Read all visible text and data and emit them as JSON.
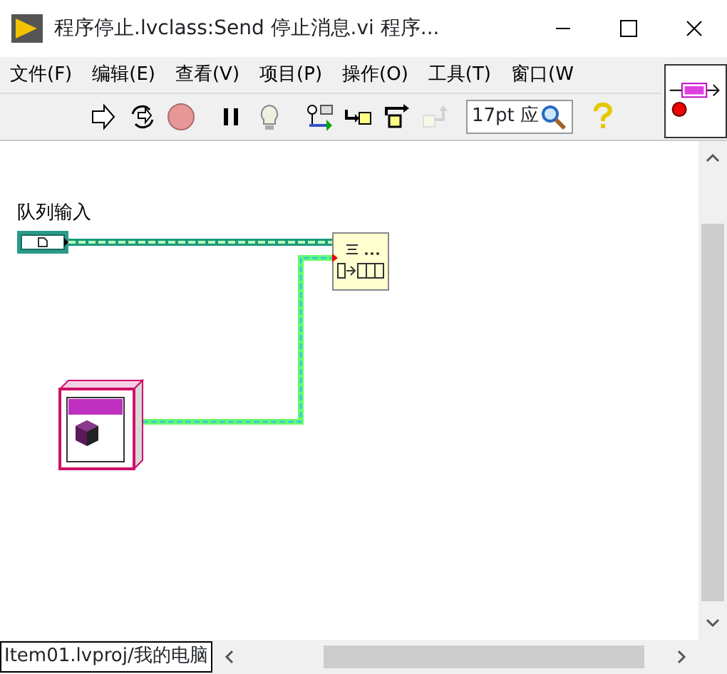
{
  "window": {
    "title": "程序停止.lvclass:Send 停止消息.vi 程序..."
  },
  "menu": [
    {
      "label": "文件(F)"
    },
    {
      "label": "编辑(E)"
    },
    {
      "label": "查看(V)"
    },
    {
      "label": "项目(P)"
    },
    {
      "label": "操作(O)"
    },
    {
      "label": "工具(T)"
    },
    {
      "label": "窗口(W"
    }
  ],
  "toolbar": [
    {
      "kind": "run",
      "disabled": false
    },
    {
      "kind": "run-continuous",
      "disabled": false
    },
    {
      "kind": "abort",
      "disabled": true
    },
    {
      "kind": "pause",
      "disabled": false
    },
    {
      "kind": "highlight",
      "disabled": false
    },
    {
      "kind": "retain",
      "disabled": false
    },
    {
      "kind": "step-into",
      "disabled": false
    },
    {
      "kind": "step-over",
      "disabled": false
    },
    {
      "kind": "step-out",
      "disabled": true
    }
  ],
  "font_selector": {
    "value": "17pt 应"
  },
  "diagram": {
    "control_label": "队列输入"
  },
  "status_bar": {
    "context": "Item01.lvproj/我的电脑"
  }
}
